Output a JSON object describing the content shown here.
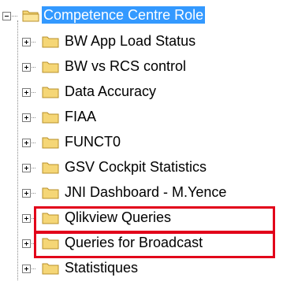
{
  "tree": {
    "root": {
      "label": "Competence Centre Role",
      "expanded": true,
      "selected": true
    },
    "children": [
      {
        "label": "BW App Load Status",
        "expander": "plus"
      },
      {
        "label": "BW vs RCS control",
        "expander": "plus"
      },
      {
        "label": "Data Accuracy",
        "expander": "plus"
      },
      {
        "label": "FIAA",
        "expander": "plus"
      },
      {
        "label": "FUNCT0",
        "expander": "plus"
      },
      {
        "label": "GSV Cockpit Statistics",
        "expander": "plus"
      },
      {
        "label": "JNI Dashboard - M.Yence",
        "expander": "plus"
      },
      {
        "label": "Qlikview Queries",
        "expander": "plus",
        "highlighted": true
      },
      {
        "label": "Queries for Broadcast",
        "expander": "plus",
        "highlighted": true
      },
      {
        "label": "Statistiques",
        "expander": "plus"
      }
    ]
  },
  "colors": {
    "selection": "#3399ff",
    "highlight_border": "#e2001a",
    "folder_fill": "#f5d676",
    "folder_stroke": "#b8902b"
  }
}
